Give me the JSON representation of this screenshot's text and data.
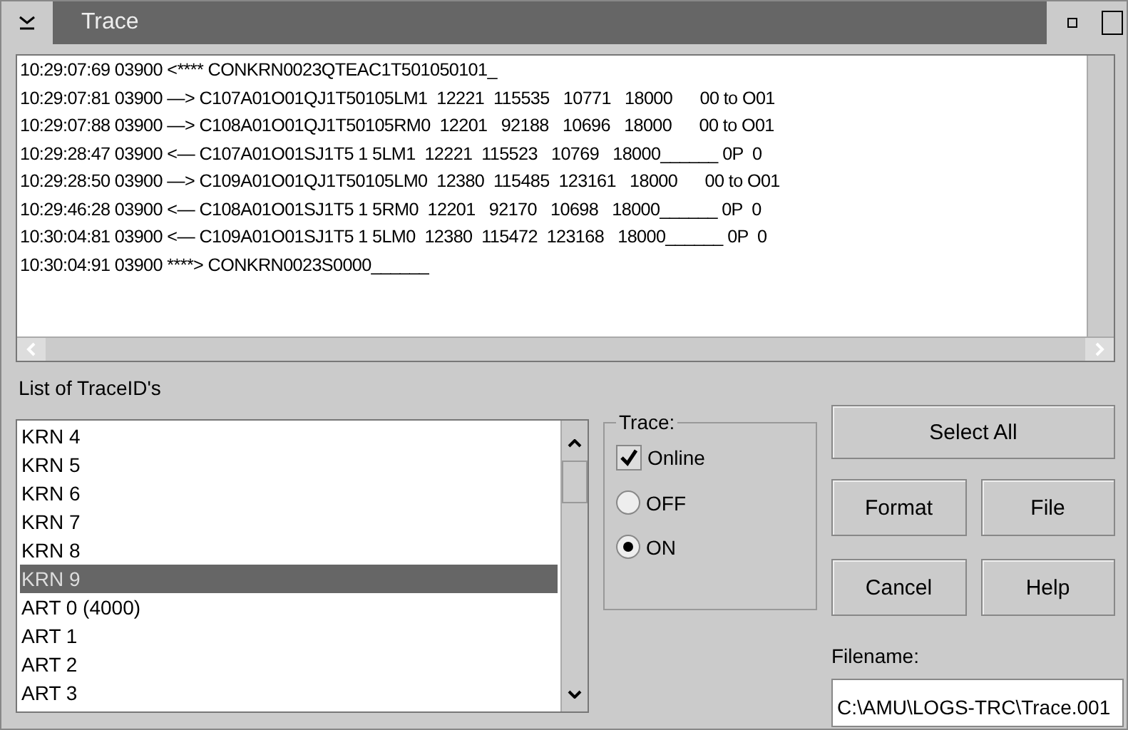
{
  "window": {
    "title": "Trace"
  },
  "log_lines": [
    "10:29:07:69 03900 <**** CONKRN0023QTEAC1T501050101_",
    "10:29:07:81 03900 —> C107A01O01QJ1T50105LM1  12221  115535   10771   18000      00 to O01",
    "10:29:07:88 03900 —> C108A01O01QJ1T50105RM0  12201   92188   10696   18000      00 to O01",
    "10:29:28:47 03900 <— C107A01O01SJ1T5 1 5LM1  12221  115523   10769   18000______ 0P  0",
    "10:29:28:50 03900 —> C109A01O01QJ1T50105LM0  12380  115485  123161   18000      00 to O01",
    "10:29:46:28 03900 <— C108A01O01SJ1T5 1 5RM0  12201   92170   10698   18000______ 0P  0",
    "10:30:04:81 03900 <— C109A01O01SJ1T5 1 5LM0  12380  115472  123168   18000______ 0P  0",
    "10:30:04:91 03900 ****> CONKRN0023S0000______"
  ],
  "list_label": "List of TraceID's",
  "trace_ids": [
    {
      "label": "KRN 4",
      "selected": false
    },
    {
      "label": "KRN 5",
      "selected": false
    },
    {
      "label": "KRN 6",
      "selected": false
    },
    {
      "label": "KRN 7",
      "selected": false
    },
    {
      "label": "KRN 8",
      "selected": false
    },
    {
      "label": "KRN 9",
      "selected": true
    },
    {
      "label": "ART 0 (4000)",
      "selected": false
    },
    {
      "label": "ART 1",
      "selected": false
    },
    {
      "label": "ART 2",
      "selected": false
    },
    {
      "label": "ART 3",
      "selected": false
    }
  ],
  "trace_group": {
    "title": "Trace:",
    "online": {
      "label": "Online",
      "checked": true
    },
    "modes": [
      {
        "label": "OFF",
        "selected": false
      },
      {
        "label": "ON",
        "selected": true
      }
    ]
  },
  "buttons": {
    "select_all": "Select All",
    "format": "Format",
    "file": "File",
    "cancel": "Cancel",
    "help": "Help"
  },
  "filename": {
    "label": "Filename:",
    "value": "C:\\AMU\\LOGS-TRC\\Trace.001"
  }
}
